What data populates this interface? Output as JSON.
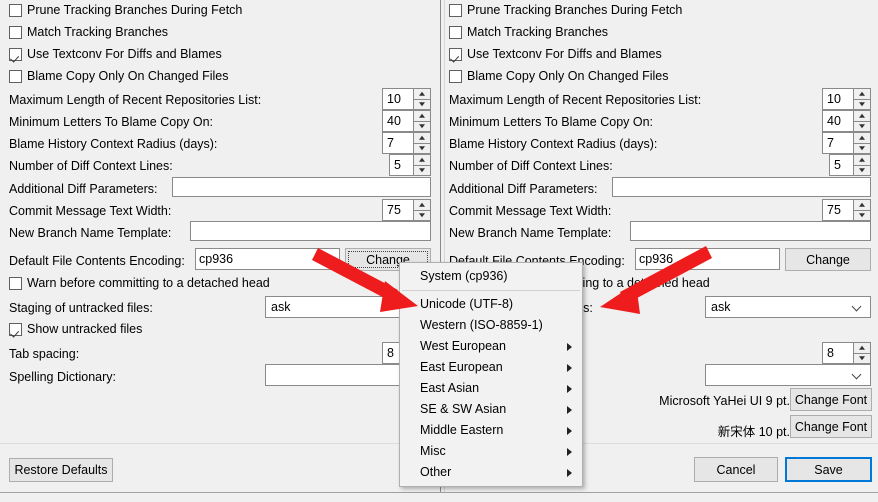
{
  "dialog": {
    "checkboxes_top": [
      {
        "label": "Prune Tracking Branches During Fetch",
        "checked": false
      },
      {
        "label": "Match Tracking Branches",
        "checked": false
      },
      {
        "label": "Use Textconv For Diffs and Blames",
        "checked": true
      },
      {
        "label": "Blame Copy Only On Changed Files",
        "checked": false
      }
    ],
    "spin_rows": [
      {
        "label": "Maximum Length of Recent Repositories List:",
        "value": "10"
      },
      {
        "label": "Minimum Letters To Blame Copy On:",
        "value": "40"
      },
      {
        "label": "Blame History Context Radius (days):",
        "value": "7"
      },
      {
        "label": "Number of Diff Context Lines:",
        "value": "5"
      }
    ],
    "text_rows": [
      {
        "label": "Additional Diff Parameters:",
        "value": ""
      },
      {
        "label": "New Branch Name Template:",
        "value": ""
      }
    ],
    "commit_width": {
      "label": "Commit Message Text Width:",
      "value": "75"
    },
    "encoding": {
      "label": "Default File Contents Encoding:",
      "value": "cp936",
      "button": "Change"
    },
    "detached_head": {
      "label": "Warn before committing to a detached head",
      "checked": false
    },
    "staging": {
      "label": "Staging of untracked files:",
      "value": "ask"
    },
    "show_untracked": {
      "label": "Show untracked files",
      "checked": true
    },
    "tab_spacing": {
      "label": "Tab spacing:",
      "value": "8"
    },
    "spelling": {
      "label": "Spelling Dictionary:",
      "value": ""
    },
    "fonts": [
      {
        "value": "Microsoft YaHei UI 9 pt.",
        "button": "Change Font"
      },
      {
        "value": "新宋体 10 pt.",
        "button": "Change Font"
      }
    ],
    "restore_defaults": "Restore Defaults",
    "cancel": "Cancel",
    "save": "Save"
  },
  "encoding_menu": {
    "items": [
      {
        "label": "System (cp936)",
        "submenu": false
      },
      {
        "label": "Unicode (UTF-8)",
        "submenu": false
      },
      {
        "label": "Western (ISO-8859-1)",
        "submenu": false
      },
      {
        "label": "West European",
        "submenu": true
      },
      {
        "label": "East European",
        "submenu": true
      },
      {
        "label": "East Asian",
        "submenu": true
      },
      {
        "label": "SE & SW Asian",
        "submenu": true
      },
      {
        "label": "Middle Eastern",
        "submenu": true
      },
      {
        "label": "Misc",
        "submenu": true
      },
      {
        "label": "Other",
        "submenu": true
      }
    ]
  },
  "annotations": {
    "arrow_color": "#ee1c1c",
    "arrows": [
      {
        "name": "left-red-arrow",
        "points_to": "Unicode (UTF-8)"
      },
      {
        "name": "right-red-arrow",
        "points_to": "Unicode (UTF-8)"
      }
    ]
  },
  "colors": {
    "background": "#f0f0f0",
    "field_bg": "#ffffff",
    "border": "#8a8a8a",
    "accent": "#0078d7",
    "arrow_red": "#ee1c1c"
  }
}
